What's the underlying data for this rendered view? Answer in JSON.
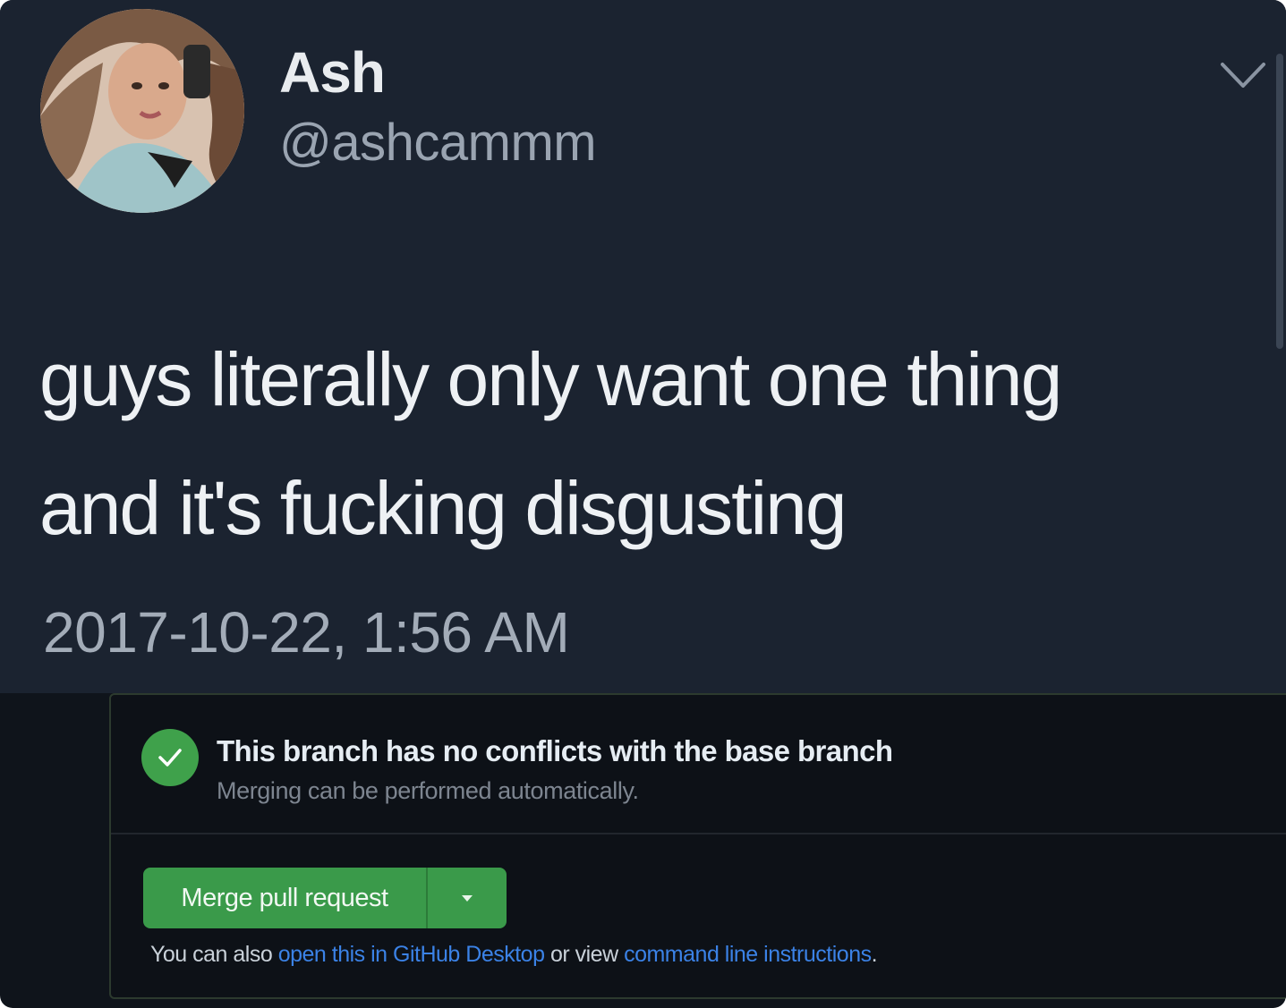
{
  "tweet": {
    "display_name": "Ash",
    "handle": "@ashcammm",
    "text_line1": "guys literally only want one thing",
    "text_line2": "and it's fucking disgusting",
    "timestamp": "2017-10-22, 1:56 AM",
    "avatar_icon": "avatar-photo",
    "menu_icon": "chevron-down-icon"
  },
  "merge_box": {
    "status_title": "This branch has no conflicts with the base branch",
    "status_subtitle": "Merging can be performed automatically.",
    "merge_button_label": "Merge pull request",
    "also_prefix": "You can also",
    "desktop_link": "open this in GitHub Desktop",
    "or_view": "or view",
    "cli_link": "command line instructions",
    "period": "."
  },
  "colors": {
    "tweet_bg": "#1b2330",
    "github_bg": "#0d1117",
    "success_green": "#3fa14b",
    "link_blue": "#3b82e6"
  }
}
